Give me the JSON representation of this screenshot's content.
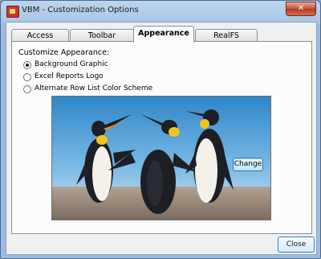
{
  "window": {
    "title": "VBM - Customization Options",
    "close_glyph": "✕"
  },
  "tabs": [
    {
      "label": "Access",
      "active": false
    },
    {
      "label": "Toolbar",
      "active": false
    },
    {
      "label": "Appearance",
      "active": true
    },
    {
      "label": "RealFS",
      "active": false
    }
  ],
  "appearance": {
    "group_label": "Customize Appearance:",
    "options": [
      {
        "label": "Background Graphic",
        "checked": true
      },
      {
        "label": "Excel Reports Logo",
        "checked": false
      },
      {
        "label": "Alternate Row List Color Scheme",
        "checked": false
      }
    ],
    "preview_image": "penguins-photo",
    "change_label": "Change"
  },
  "footer": {
    "close_label": "Close"
  }
}
